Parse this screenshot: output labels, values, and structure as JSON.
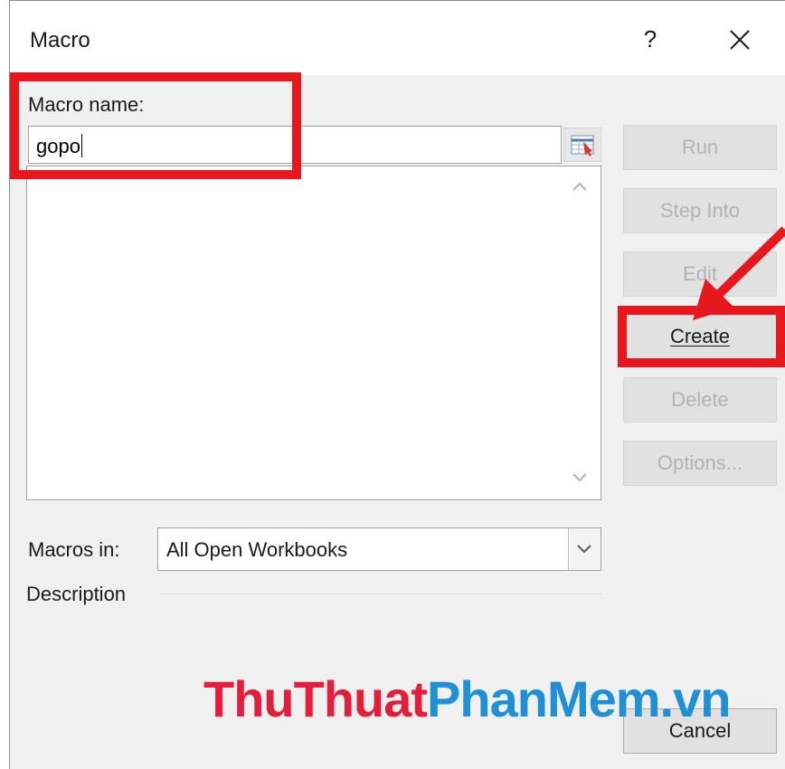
{
  "dialog": {
    "title": "Macro",
    "help_label": "?",
    "macro_name_label": "Macro name:",
    "macro_name_value": "gopo",
    "macros_in_label": "Macros in:",
    "macros_in_value": "All Open Workbooks",
    "description_label": "Description"
  },
  "buttons": {
    "run": "Run",
    "step_into": "Step Into",
    "edit": "Edit",
    "create": "Create",
    "delete": "Delete",
    "options": "Options...",
    "cancel": "Cancel"
  },
  "watermark": {
    "part1": "ThuThuat",
    "part2": "PhanMem",
    "part3": ".vn",
    "color1": "#e31e3c",
    "color2": "#1f8fd6"
  },
  "annotation_color": "#e8161d"
}
